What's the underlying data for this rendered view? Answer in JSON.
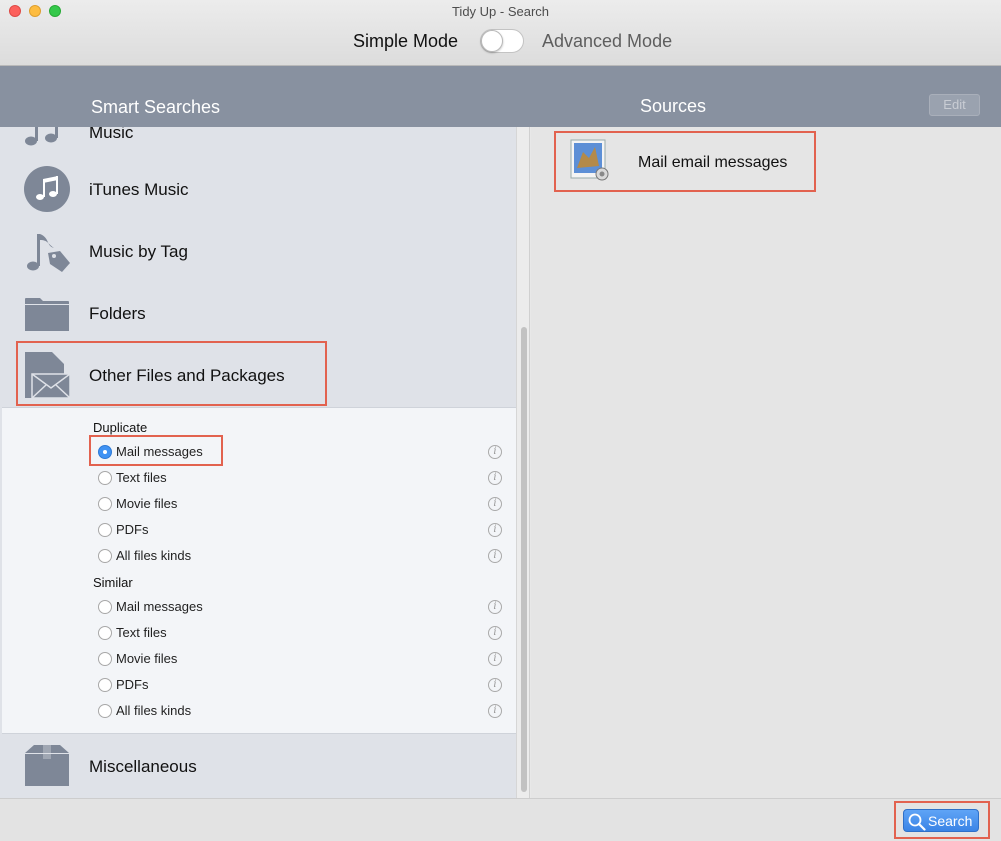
{
  "window": {
    "title": "Tidy Up - Search"
  },
  "mode": {
    "simple_label": "Simple Mode",
    "advanced_label": "Advanced Mode",
    "toggle_on": false
  },
  "header": {
    "left_title": "Smart Searches",
    "right_title": "Sources",
    "edit_label": "Edit"
  },
  "smart_searches": [
    {
      "label": "Music",
      "icon": "music-note-icon"
    },
    {
      "label": "iTunes Music",
      "icon": "itunes-icon"
    },
    {
      "label": "Music by Tag",
      "icon": "music-tag-icon"
    },
    {
      "label": "Folders",
      "icon": "folder-icon"
    },
    {
      "label": "Other Files and Packages",
      "icon": "document-mail-icon"
    },
    {
      "label": "Miscellaneous",
      "icon": "box-icon"
    }
  ],
  "options": {
    "duplicate": {
      "title": "Duplicate",
      "items": [
        "Mail messages",
        "Text files",
        "Movie files",
        "PDFs",
        "All files kinds"
      ],
      "selected": "Mail messages"
    },
    "similar": {
      "title": "Similar",
      "items": [
        "Mail messages",
        "Text files",
        "Movie files",
        "PDFs",
        "All files kinds"
      ],
      "selected": null
    }
  },
  "sources": [
    {
      "label": "Mail email messages",
      "icon": "mail-app-icon"
    }
  ],
  "footer": {
    "search_label": "Search",
    "search_icon": "magnifier-icon"
  },
  "colors": {
    "header": "#8891a0",
    "highlight": "#e2624f",
    "accent": "#3f92f3"
  }
}
